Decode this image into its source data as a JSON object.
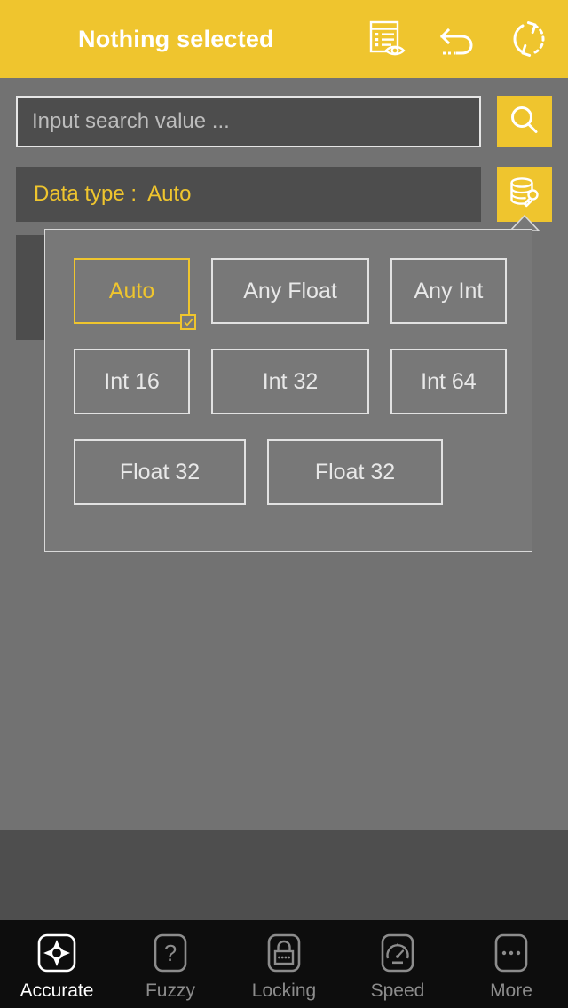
{
  "header": {
    "title": "Nothing selected",
    "actions": [
      {
        "name": "document-preview-icon",
        "label": "Document preview"
      },
      {
        "name": "undo-icon",
        "label": "Undo"
      },
      {
        "name": "refresh-icon",
        "label": "Refresh"
      }
    ]
  },
  "search": {
    "placeholder": "Input search value ...",
    "value": "",
    "button_icon": "search-icon"
  },
  "datatype": {
    "label": "Data type :",
    "value": "Auto",
    "button_icon": "database-key-icon"
  },
  "dropdown": {
    "selected": "Auto",
    "rows": [
      [
        {
          "label": "Auto",
          "selected": true,
          "width": "w-std"
        },
        {
          "label": "Any Float",
          "selected": false,
          "width": "w-wide"
        },
        {
          "label": "Any Int",
          "selected": false,
          "width": "w-std"
        }
      ],
      [
        {
          "label": "Int 16",
          "selected": false,
          "width": "w-std"
        },
        {
          "label": "Int 32",
          "selected": false,
          "width": "w-wide"
        },
        {
          "label": "Int 64",
          "selected": false,
          "width": "w-std"
        }
      ],
      [
        {
          "label": "Float 32",
          "selected": false,
          "width": "w-wide2"
        },
        {
          "label": "Float 32",
          "selected": false,
          "width": "w-wide"
        }
      ]
    ]
  },
  "tabs": [
    {
      "label": "Accurate",
      "icon": "crosshair-icon",
      "active": true
    },
    {
      "label": "Fuzzy",
      "icon": "question-mark-icon",
      "active": false
    },
    {
      "label": "Locking",
      "icon": "lock-icon",
      "active": false
    },
    {
      "label": "Speed",
      "icon": "speedometer-icon",
      "active": false
    },
    {
      "label": "More",
      "icon": "ellipsis-icon",
      "active": false
    }
  ],
  "colors": {
    "accent": "#EFC52E",
    "background": "#727272",
    "field": "#4D4D4D",
    "popup": "#787878",
    "tabbar": "#0D0D0D",
    "mid_band": "#4E4E4E"
  }
}
